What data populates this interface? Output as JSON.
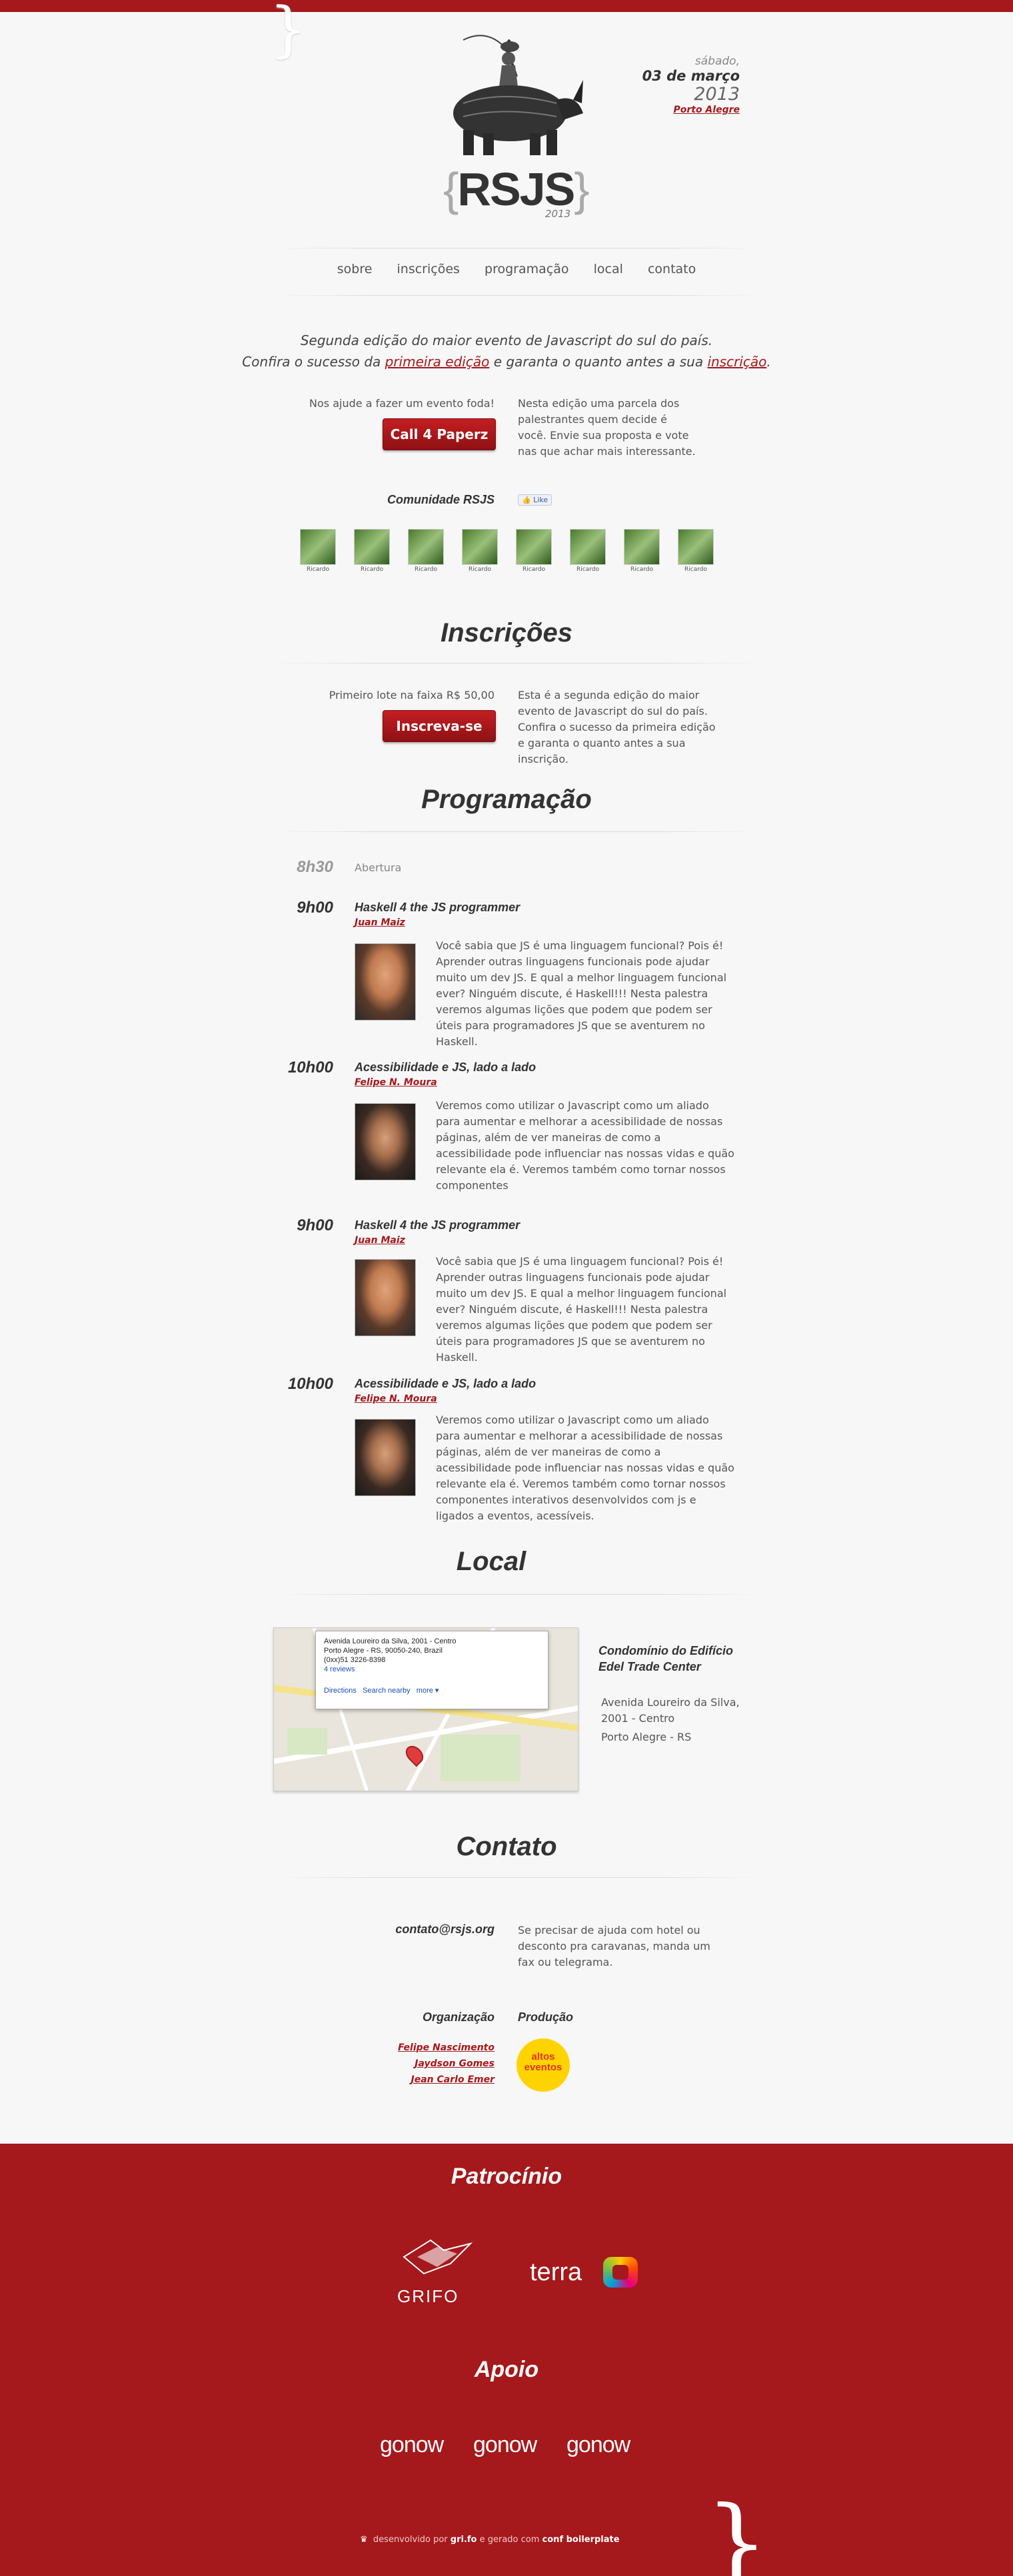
{
  "header": {
    "day": "sábado,",
    "date": "03 de março",
    "year": "2013",
    "city": "Porto Alegre",
    "logo_text": "RSJS",
    "logo_year": "2013"
  },
  "nav": {
    "items": [
      "sobre",
      "inscrições",
      "programação",
      "local",
      "contato"
    ]
  },
  "intro": {
    "line1": "Segunda edição do maior evento de Javascript do sul do país.",
    "line2_a": "Confira o sucesso da ",
    "line2_link1": "primeira edição",
    "line2_b": " e garanta o quanto antes a sua ",
    "line2_link2": "inscrição",
    "line2_c": "."
  },
  "call": {
    "help": "Nos ajude a fazer um evento foda!",
    "button": "Call 4 Paperz",
    "text": "Nesta edição uma parcela dos palestrantes quem decide é você. Envie sua proposta e vote nas que achar mais interessante."
  },
  "community": {
    "title": "Comunidade RSJS",
    "like": "Like",
    "members": [
      "Ricardo",
      "Ricardo",
      "Ricardo",
      "Ricardo",
      "Ricardo",
      "Ricardo",
      "Ricardo",
      "Ricardo"
    ]
  },
  "inscricoes": {
    "title": "Inscrições",
    "lote": "Primeiro lote na faixa R$ 50,00",
    "button": "Inscreva-se",
    "text": "Esta é a segunda edição do maior evento de Javascript do sul do país. Confira o sucesso da primeira edição e garanta o quanto antes a sua inscrição."
  },
  "programacao": {
    "title": "Programação",
    "opening_time": "8h30",
    "opening_label": "Abertura",
    "talks": [
      {
        "time": "9h00",
        "title": "Haskell 4 the JS programmer",
        "speaker": "Juan Maiz",
        "bio": "Você sabia que JS é uma linguagem funcional? Pois é! Aprender outras linguagens funcionais pode ajudar muito um dev JS. E qual a melhor linguagem funcional ever? Ninguém discute, é Haskell!!! Nesta palestra veremos algumas lições que podem que podem ser úteis para programadores JS que se aventurem no Haskell."
      },
      {
        "time": "10h00",
        "title": "Acessibilidade e JS, lado a lado",
        "speaker": "Felipe N. Moura",
        "bio": "Veremos como utilizar o Javascript como um aliado para aumentar e melhorar a acessibilidade de nossas páginas, além de ver maneiras de como a acessibilidade pode influenciar nas nossas vidas e quão relevante ela é. Veremos também como tornar nossos componentes"
      },
      {
        "time": "9h00",
        "title": "Haskell 4 the JS programmer",
        "speaker": "Juan Maiz",
        "bio": "Você sabia que JS é uma linguagem funcional? Pois é! Aprender outras linguagens funcionais pode ajudar muito um dev JS. E qual a melhor linguagem funcional ever? Ninguém discute, é Haskell!!! Nesta palestra veremos algumas lições que podem que podem ser úteis para programadores JS que se aventurem no Haskell."
      },
      {
        "time": "10h00",
        "title": "Acessibilidade e JS, lado a lado",
        "speaker": "Felipe N. Moura",
        "bio": "Veremos como utilizar o Javascript como um aliado para aumentar e melhorar a acessibilidade de nossas páginas, além de ver maneiras de como a acessibilidade pode influenciar nas nossas vidas e quão relevante ela é. Veremos também como tornar nossos componentes interativos desenvolvidos com js e ligados a eventos, acessíveis."
      }
    ]
  },
  "local": {
    "title": "Local",
    "venue": "Condomínio do Edifício Edel Trade Center",
    "address": "Avenida Loureiro da Silva, 2001 - Centro",
    "city": "Porto Alegre - RS",
    "map_popup": {
      "line1": "Avenida Loureiro da Silva, 2001 - Centro",
      "line2": "Porto Alegre - RS, 90050-240, Brazil",
      "line3": "(0xx)51 3226-8398",
      "reviews": "4 reviews",
      "directions": "Directions",
      "nearby": "Search nearby",
      "more": "more ▾"
    }
  },
  "contato": {
    "title": "Contato",
    "email": "contato@rsjs.org",
    "text": "Se precisar de ajuda com hotel ou desconto pra caravanas, manda um fax ou telegrama.",
    "org_title": "Organização",
    "organizers": [
      "Felipe Nascimento",
      "Jaydson Gomes",
      "Jean Carlo Emer"
    ],
    "prod_title": "Produção",
    "prod_logo": "altos eventos"
  },
  "patrocinio": {
    "title": "Patrocínio",
    "sponsors": [
      "GRIFO",
      "terra"
    ]
  },
  "apoio": {
    "title": "Apoio",
    "supporters": [
      "gonow",
      "gonow",
      "gonow"
    ]
  },
  "footer": {
    "a": "desenvolvido por ",
    "b": "gri.fo",
    "c": " e gerado com ",
    "d": "conf boilerplate"
  },
  "colors": {
    "brand_red": "#a5181b",
    "background": "#f7f7f7"
  }
}
